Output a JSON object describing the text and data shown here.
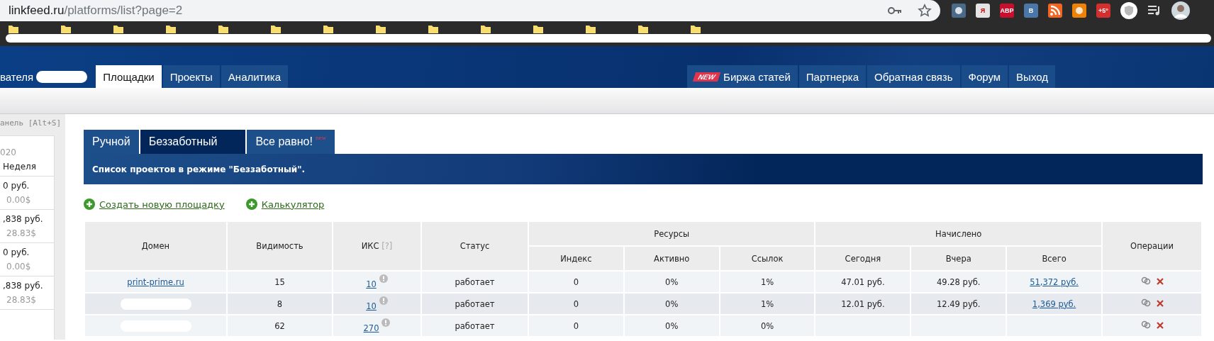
{
  "browser": {
    "url_host": "linkfeed.ru",
    "url_path": "/platforms/list?page=2",
    "extensions": [
      {
        "kind": "generic",
        "color": "#4a6a8a"
      },
      {
        "kind": "letter",
        "label": "Я",
        "color": "#e4e4e4"
      },
      {
        "kind": "letter",
        "label": "ABP",
        "color": "#c8102e"
      },
      {
        "kind": "letter",
        "label": "B",
        "color": "#4a76a8"
      },
      {
        "kind": "rss",
        "color": "#f26522"
      },
      {
        "kind": "generic",
        "color": "#ee8208"
      },
      {
        "kind": "letter",
        "label": "+5°",
        "color": "#d32f2f"
      },
      {
        "kind": "shield",
        "color": "#ffffff"
      }
    ]
  },
  "nav": {
    "user_partial": "вателя",
    "left_items": [
      {
        "label": "Площадки",
        "selected": true
      },
      {
        "label": "Проекты",
        "selected": false
      },
      {
        "label": "Аналитика",
        "selected": false
      }
    ],
    "right_items": [
      {
        "label": "Биржа статей",
        "badge": "NEW"
      },
      {
        "label": "Партнерка"
      },
      {
        "label": "Обратная связь"
      },
      {
        "label": "Форум"
      },
      {
        "label": "Выход"
      }
    ]
  },
  "sidebar": {
    "hint": "анель [Alt+S]",
    "date": "020",
    "period": "Неделя",
    "rows": [
      {
        "amount": "0 руб.",
        "usd": "0.00$"
      },
      {
        "amount": ",838 руб.",
        "usd": "28.83$"
      },
      {
        "amount": "0 руб.",
        "usd": "0.00$"
      },
      {
        "amount": ",838 руб.",
        "usd": "28.83$"
      }
    ]
  },
  "mode_tabs": [
    {
      "label": "Ручной",
      "selected": false
    },
    {
      "label": "Беззаботный",
      "selected": true
    },
    {
      "label": "Все равно!",
      "badge": "new",
      "selected": false
    }
  ],
  "mode_description": "Список проектов в режиме \"Беззаботный\".",
  "actions": [
    "Создать новую площадку",
    "Калькулятор"
  ],
  "table": {
    "columns": [
      "Домен",
      "Видимость",
      "ИКС",
      "Статус"
    ],
    "iks_help": "[?]",
    "groups": [
      {
        "label": "Ресурсы",
        "columns": [
          "Индекс",
          "Активно",
          "Ссылок"
        ]
      },
      {
        "label": "Начислено",
        "columns": [
          "Сегодня",
          "Вчера",
          "Всего"
        ]
      }
    ],
    "last_column": "Операции",
    "rows": [
      {
        "domain": "print-prime.ru",
        "visibility": "15",
        "iks": "10",
        "status": "работает",
        "index": "0",
        "active": "0%",
        "links": "1%",
        "today": "47.01 руб.",
        "yesterday": "49.28 руб.",
        "total": "51,372 руб."
      },
      {
        "domain_redacted": true,
        "visibility": "8",
        "iks": "10",
        "status": "работает",
        "index": "0",
        "active": "0%",
        "links": "1%",
        "today": "12.01 руб.",
        "yesterday": "12.49 руб.",
        "total": "1,369 руб."
      },
      {
        "domain_redacted": true,
        "visibility": "62",
        "iks": "270",
        "status": "работает",
        "index": "0",
        "active": "0%",
        "links": "0%"
      }
    ]
  }
}
